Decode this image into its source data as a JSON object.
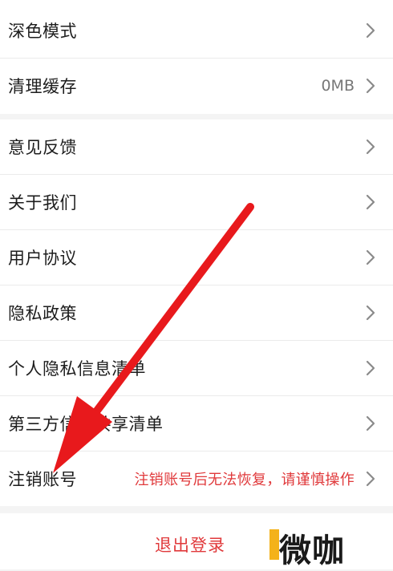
{
  "settings": {
    "group1": [
      {
        "label": "深色模式",
        "value": ""
      },
      {
        "label": "清理缓存",
        "value": "0MB"
      }
    ],
    "group2": [
      {
        "label": "意见反馈",
        "value": ""
      },
      {
        "label": "关于我们",
        "value": ""
      },
      {
        "label": "用户协议",
        "value": ""
      },
      {
        "label": "隐私政策",
        "value": ""
      },
      {
        "label": "个人隐私信息清单",
        "value": ""
      },
      {
        "label": "第三方信息共享清单",
        "value": ""
      },
      {
        "label": "注销账号",
        "value": "注销账号后无法恢复，请谨慎操作"
      }
    ]
  },
  "logout": {
    "label": "退出登录"
  },
  "watermark": {
    "text": "微咖"
  },
  "colors": {
    "accent_red": "#e0393b",
    "arrow_red": "#e8191c",
    "background": "#f4f4f4",
    "watermark_yellow": "#f4b21a"
  },
  "icons": {
    "row_chevron": "chevron-right-icon"
  }
}
